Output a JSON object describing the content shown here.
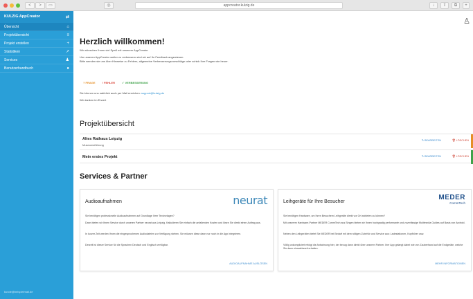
{
  "browser": {
    "url": "appcreator.kulzig.de",
    "back": "<",
    "forward": ">",
    "sidebar_toggle": "▭"
  },
  "sidebar": {
    "title": "KULZIG AppCreator",
    "items": [
      {
        "label": "Übersicht",
        "icon": "home-icon"
      },
      {
        "label": "Projektübersicht",
        "icon": "list-icon"
      },
      {
        "label": "Projekt erstellen",
        "icon": "plus-icon"
      },
      {
        "label": "Statistiken",
        "icon": "chart-icon"
      },
      {
        "label": "Services",
        "icon": "people-icon"
      },
      {
        "label": "Benutzerhandbuch",
        "icon": "help-icon"
      }
    ],
    "footer": "kunde@beispielmail.de"
  },
  "welcome": {
    "title": "Herzlich willkommen!",
    "line1": "Wir wünschen Ihnen viel Spaß mit unserem AppCreator.",
    "line2": "Um unseren AppCreator weiter zu verbessern sind wir auf Ihr Feedback angewiesen.",
    "line3": "Bitte wenden sie uns über Hinweise zu Fehlern, allgemeine Verbesserungsvorschläge oder schick Ihre Fragen wie heuer.",
    "badge_question": "? FRAGE",
    "badge_error": "! FEHLER",
    "badge_improvement": "✓ VERBESSERUNG",
    "mail_prefix": "Sie können uns natürlich auch per Mail erreichen: ",
    "mail_link": "support@kulzig.de",
    "thanks": "Wir danken im Erwert"
  },
  "projects": {
    "section_title": "Projektübersicht",
    "edit_label": "✎ BEARBEITEN",
    "delete_label": "🗑 LÖSCHEN",
    "items": [
      {
        "name": "Altes Rathaus Leipzig",
        "subtitle": "Museumsführung",
        "stripe": "#e58e26"
      },
      {
        "name": "Mein erstes Projekt",
        "subtitle": "",
        "stripe": "#3fa24a"
      }
    ]
  },
  "services": {
    "section_title": "Services & Partner",
    "cards": [
      {
        "title": "Audioaufnahmen",
        "logo": "neurat",
        "paragraphs": [
          "Sie benötigen professionelle Audioaufnahmen auf Grundlage Ihrer Textvorlagen?",
          "Dann bieten wir Ihnen Service durch unseren Partner neurat aus Leipzig. Kalkulieren Sie einfach die anfallenden Kosten und lösen Sie direkt einen Auftrag aus.",
          "In kurzer Zeit werden Ihnen die eingesprochenen Audiodateien zur Verfügung stehen. Sie müssen diese dann nur noch in die App integrieren.",
          "Derzeit ist dieser Service für die Sprachen Deutsch und Englisch verfügbar."
        ],
        "link": "AUDIOAUFNAHME AUSLÖSEN"
      },
      {
        "title": "Leihgeräte für Ihre Besucher",
        "logo": "MEDER",
        "logo_sub": "CommTech",
        "paragraphs": [
          "Sie benötigen Hardware, um Ihren Besuchern Leihgeräte direkt vor Ort anbieten zu können?",
          "Mit unserem Hardware-Partner MEDER CommTech aus Singen bieten wir Ihnen hochgradig performante und zuverlässige Multimedia Guides auf Basis von Android.",
          "Neben den Leihgeräten bietet Sie MEDER bei Bedarf mit dem nötigen Zubehör und Service aus: Ladestationen, Kopfhörer usw.",
          "Völlig unkompliziert erfolgt die Anbahnung hier, der bezug dann direkt über unseren Partner. Ihre App gelangt dabei wie von Zauberhand auf die Endgeräte, welche Sie dann einsatzbereit erhalten."
        ],
        "link": "MEHR INFORMATIONEN"
      }
    ]
  },
  "colors": {
    "sidebar": "#2a9fd8",
    "accent": "#3d8dcf",
    "danger": "#d04a3c"
  }
}
